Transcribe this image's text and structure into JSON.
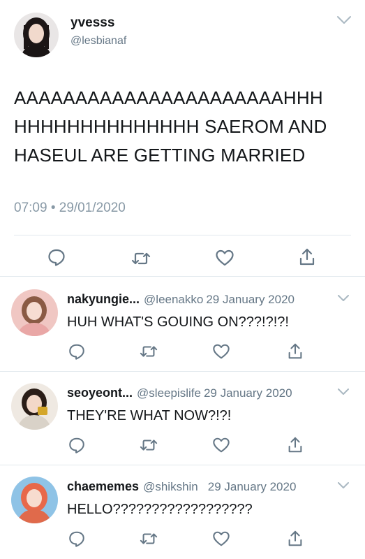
{
  "tweet": {
    "display_name": "yvesss",
    "handle": "@lesbianaf",
    "text": "AAAAAAAAAAAAAAAAAAAAAAHHH HHHHHHHHHHHHHH SAEROM AND HASEUL ARE GETTING MARRIED",
    "time": "07:09",
    "separator": "•",
    "date": "29/01/2020",
    "icons": {
      "avatar": "profile-photo",
      "menu": "chevron-down-icon",
      "reply": "reply-icon",
      "retweet": "retweet-icon",
      "like": "heart-icon",
      "share": "share-icon"
    }
  },
  "replies": [
    {
      "display_name": "nakyungie...",
      "handle": "@leenakko",
      "date": "29 January 2020",
      "text": "HUH WHAT'S GOUING ON???!?!?!",
      "avatar_color": "#d98a8a"
    },
    {
      "display_name": "seoyeont...",
      "handle": "@sleepislife",
      "date": "29 January 2020",
      "text": "THEY'RE WHAT NOW?!?!",
      "avatar_color": "#c9a35a"
    },
    {
      "display_name": "chaememes",
      "handle": "@shikshin",
      "date": "29 January 2020",
      "text": "HELLO??????????????????",
      "avatar_color": "#e8745a"
    }
  ],
  "colors": {
    "text": "#14171a",
    "secondary": "#657786",
    "meta": "#8899a6",
    "divider": "#e1e8ed",
    "icon": "#657786"
  }
}
